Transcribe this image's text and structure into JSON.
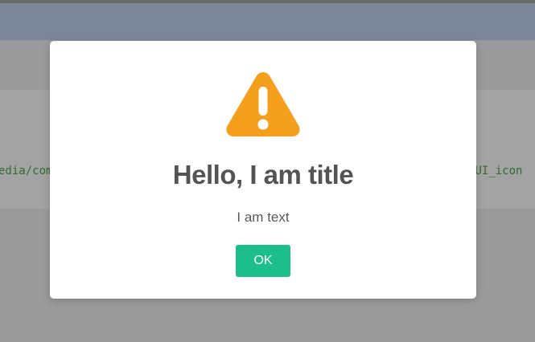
{
  "background": {
    "code_left": "edia/com",
    "code_right": "_UI_icon"
  },
  "dialog": {
    "icon": "warning-icon",
    "icon_color": "#f5a01d",
    "title": "Hello, I am title",
    "text": "I am text",
    "ok_label": "OK",
    "ok_color": "#1cbf8a"
  }
}
